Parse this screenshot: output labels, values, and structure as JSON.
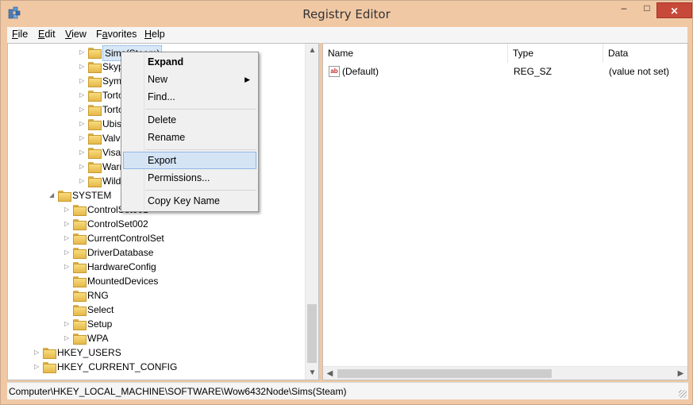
{
  "window": {
    "title": "Registry Editor",
    "min_glyph": "–",
    "max_glyph": "□",
    "close_glyph": "✕"
  },
  "menubar": {
    "items": [
      "File",
      "Edit",
      "View",
      "Favorites",
      "Help"
    ],
    "mnemonics": [
      "F",
      "E",
      "V",
      "a",
      "H"
    ]
  },
  "tree": {
    "nodes": [
      {
        "label": "Sims(Steam)",
        "expander": "▷",
        "selected": true
      },
      {
        "label": "Skype",
        "expander": "▷"
      },
      {
        "label": "Symantec",
        "expander": "▷"
      },
      {
        "label": "Tortoise",
        "expander": "▷"
      },
      {
        "label": "Tortoise",
        "expander": "▷"
      },
      {
        "label": "Ubisoft",
        "expander": "▷"
      },
      {
        "label": "Valve",
        "expander": "▷"
      },
      {
        "label": "Visa",
        "expander": "▷"
      },
      {
        "label": "Warner",
        "expander": "▷"
      },
      {
        "label": "Wild",
        "expander": "▷"
      },
      {
        "label": "SYSTEM",
        "expander": "◢"
      },
      {
        "label": "ControlSet001",
        "expander": "▷"
      },
      {
        "label": "ControlSet002",
        "expander": "▷"
      },
      {
        "label": "CurrentControlSet",
        "expander": "▷"
      },
      {
        "label": "DriverDatabase",
        "expander": "▷"
      },
      {
        "label": "HardwareConfig",
        "expander": "▷"
      },
      {
        "label": "MountedDevices",
        "expander": ""
      },
      {
        "label": "RNG",
        "expander": ""
      },
      {
        "label": "Select",
        "expander": ""
      },
      {
        "label": "Setup",
        "expander": "▷"
      },
      {
        "label": "WPA",
        "expander": "▷"
      },
      {
        "label": "HKEY_USERS",
        "expander": "▷"
      },
      {
        "label": "HKEY_CURRENT_CONFIG",
        "expander": "▷"
      }
    ]
  },
  "list": {
    "columns": [
      "Name",
      "Type",
      "Data"
    ],
    "rows": [
      {
        "name": "(Default)",
        "type": "REG_SZ",
        "data": "(value not set)",
        "icon": "ab"
      }
    ]
  },
  "context_menu": {
    "items": [
      "Expand",
      "New",
      "Find...",
      "Delete",
      "Rename",
      "Export",
      "Permissions...",
      "Copy Key Name"
    ],
    "submenu_arrow": "▶"
  },
  "statusbar": {
    "path": "Computer\\HKEY_LOCAL_MACHINE\\SOFTWARE\\Wow6432Node\\Sims(Steam)"
  },
  "scroll": {
    "up": "▲",
    "down": "▼",
    "left": "◀",
    "right": "▶"
  },
  "colors": {
    "title_bar": "#f0c8a4",
    "close_button": "#c7493a",
    "selection": "#d5e4f5"
  }
}
